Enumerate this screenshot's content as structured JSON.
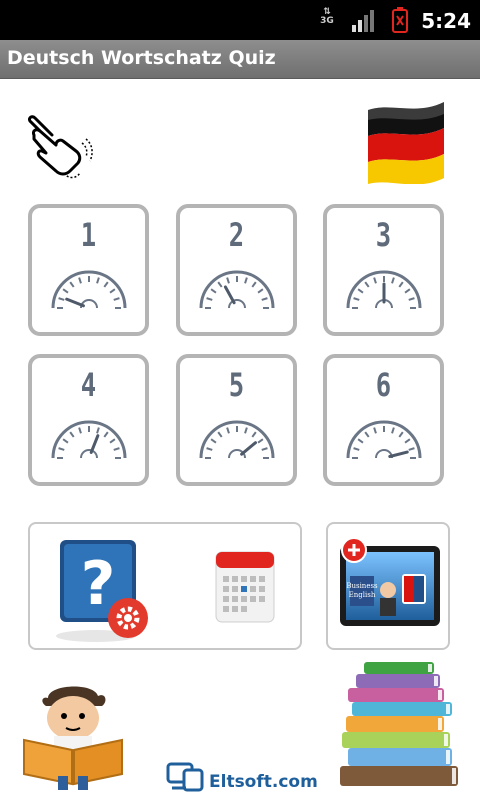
{
  "status_bar": {
    "network_type": "3G",
    "time": "5:24",
    "icons": [
      "data-arrows-icon",
      "signal-strength-icon",
      "battery-empty-icon"
    ]
  },
  "app": {
    "title": "Deutsch Wortschatz Quiz"
  },
  "top_icons": {
    "left": "tap-hand-icon",
    "right": "german-flag-icon"
  },
  "levels": [
    {
      "label": "1",
      "gauge_level": 0.12
    },
    {
      "label": "2",
      "gauge_level": 0.34
    },
    {
      "label": "3",
      "gauge_level": 0.5
    },
    {
      "label": "4",
      "gauge_level": 0.62
    },
    {
      "label": "5",
      "gauge_level": 0.78
    },
    {
      "label": "6",
      "gauge_level": 0.92
    }
  ],
  "bottom_buttons": {
    "quiz_settings": "help-settings-icon",
    "calendar": "calendar-icon",
    "more_apps": "tablet-apps-icon",
    "tablet_caption": [
      "Business",
      "English"
    ]
  },
  "footer": {
    "brand": "Eltsoft.com",
    "left_illustration": "reading-boy-icon",
    "right_illustration": "book-stack-icon"
  },
  "colors": {
    "status_bar": "#000000",
    "title_bar": "#7f7f7f",
    "tile_border": "#b4b4b4",
    "level_text": "#5f6b7a",
    "brand": "#1f5f9b",
    "flag_black": "#111111",
    "flag_red": "#d9140e",
    "flag_gold": "#f7c800"
  }
}
